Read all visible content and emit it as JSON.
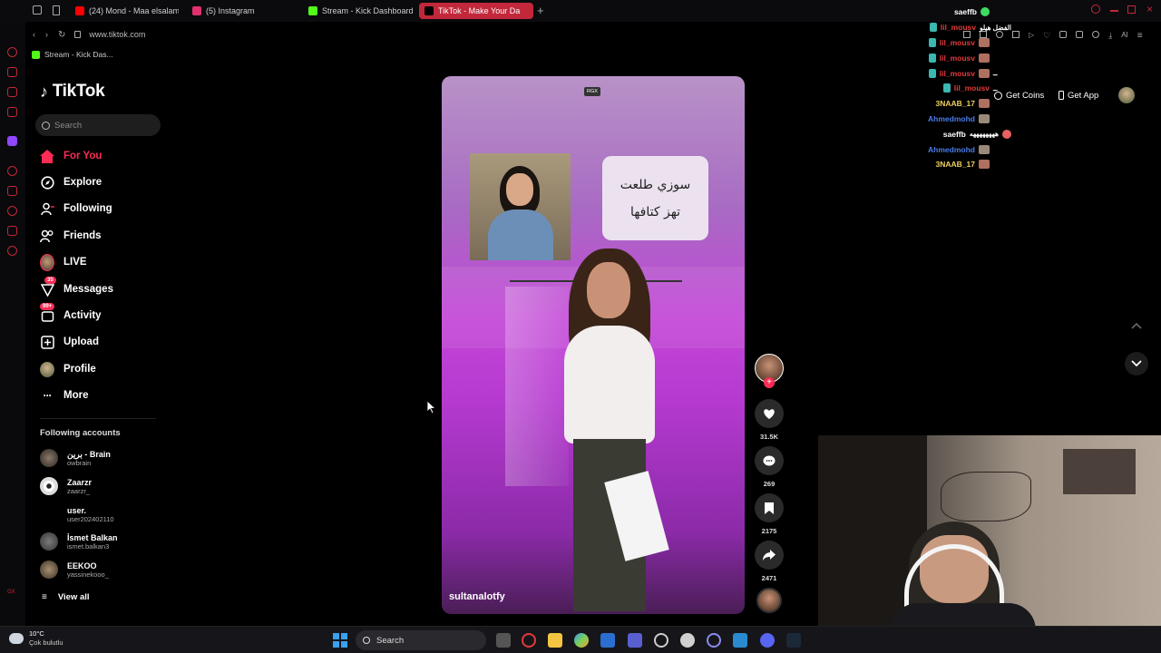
{
  "browser": {
    "tabs": [
      {
        "label": "(24) Mond - Maa elsalama",
        "color": "#ff0000"
      },
      {
        "label": "(5) Instagram",
        "color": "#e1306c"
      },
      {
        "label": "Stream - Kick Dashboard",
        "color": "#53fc18"
      },
      {
        "label": "TikTok - Make Your Da",
        "color": "#000000"
      }
    ],
    "url": "www.tiktok.com",
    "bookmark": "Stream - Kick Das..."
  },
  "tiktok": {
    "logo": "TikTok",
    "search_placeholder": "Search",
    "nav": [
      {
        "label": "For You",
        "icon": "home-icon"
      },
      {
        "label": "Explore",
        "icon": "compass-icon"
      },
      {
        "label": "Following",
        "icon": "following-icon"
      },
      {
        "label": "Friends",
        "icon": "friends-icon"
      },
      {
        "label": "LIVE",
        "icon": "live-icon"
      },
      {
        "label": "Messages",
        "icon": "messages-icon",
        "badge": "35"
      },
      {
        "label": "Activity",
        "icon": "activity-icon",
        "badge": "99+"
      },
      {
        "label": "Upload",
        "icon": "upload-icon"
      },
      {
        "label": "Profile",
        "icon": "profile-avatar"
      },
      {
        "label": "More",
        "icon": "more-icon"
      }
    ],
    "following_title": "Following accounts",
    "following": [
      {
        "name": "برين - Brain",
        "handle": "owbrain"
      },
      {
        "name": "Zaarzr",
        "handle": "zaarzr_"
      },
      {
        "name": "user.",
        "handle": "user202402110"
      },
      {
        "name": "İsmet Balkan",
        "handle": "ismet.balkan3"
      },
      {
        "name": "EEKOO",
        "handle": "yassinekooo_"
      }
    ],
    "view_all": "View all",
    "get_coins": "Get Coins",
    "get_app": "Get App"
  },
  "video": {
    "watermark": "RGX",
    "caption_line1": "سوزي طلعت",
    "caption_line2": "تهز كتافها",
    "username": "sultanalotfy",
    "likes": "31.5K",
    "comments": "269",
    "saves": "2175",
    "shares": "2471"
  },
  "chat": [
    {
      "user": "saeffb",
      "msg": "",
      "color": "#ffffff"
    },
    {
      "user": "lil_mousv",
      "msg": "الفضل هيلو",
      "color": "#e43a3a"
    },
    {
      "user": "lil_mousv",
      "msg": "",
      "color": "#e43a3a"
    },
    {
      "user": "lil_mousv",
      "msg": "",
      "color": "#e43a3a"
    },
    {
      "user": "lil_mousv",
      "msg": "ــ",
      "color": "#e43a3a"
    },
    {
      "user": "lil_mousv",
      "msg": "ــ",
      "color": "#e43a3a"
    },
    {
      "user": "3NAAB_17",
      "msg": "",
      "color": "#f0d060"
    },
    {
      "user": "Ahmedmohd",
      "msg": "",
      "color": "#4a7ce8"
    },
    {
      "user": "saeffb",
      "msg": "ههههههههه",
      "color": "#ffffff"
    },
    {
      "user": "Ahmedmohd",
      "msg": "",
      "color": "#4a7ce8"
    },
    {
      "user": "3NAAB_17",
      "msg": "",
      "color": "#f0d060"
    }
  ],
  "taskbar": {
    "temp": "10°C",
    "weather": "Çok bulutlu",
    "search": "Search"
  }
}
